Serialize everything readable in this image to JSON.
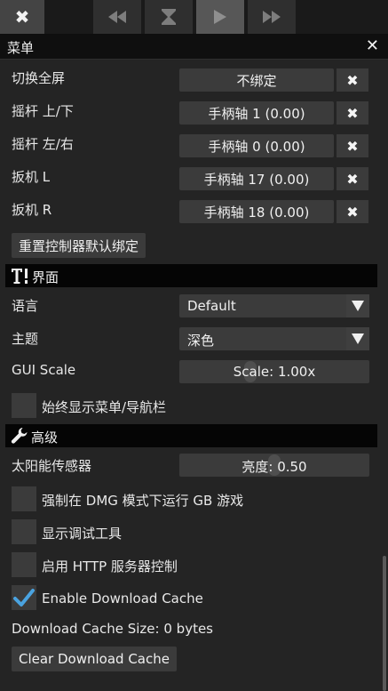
{
  "menu": {
    "title": "菜单"
  },
  "bindings": {
    "rows": [
      {
        "label": "切换全屏",
        "value": "不绑定"
      },
      {
        "label": "摇杆 上/下",
        "value": "手柄轴 1 (0.00)"
      },
      {
        "label": "摇杆 左/右",
        "value": "手柄轴 0 (0.00)"
      },
      {
        "label": "扳机 L",
        "value": "手柄轴 17 (0.00)"
      },
      {
        "label": "扳机 R",
        "value": "手柄轴 18 (0.00)"
      }
    ],
    "reset_label": "重置控制器默认绑定"
  },
  "interface": {
    "title": "界面",
    "language_label": "语言",
    "language_value": "Default",
    "theme_label": "主题",
    "theme_value": "深色",
    "gui_scale_label": "GUI Scale",
    "gui_scale_value": "Scale: 1.00x",
    "gui_scale_level": 0.25,
    "always_show_label": "始终显示菜单/导航栏",
    "always_show_checked": false
  },
  "advanced": {
    "title": "高级",
    "solar_label": "太阳能传感器",
    "solar_value": "亮度: 0.50",
    "solar_level": 0.5,
    "options": [
      {
        "label": "强制在 DMG 模式下运行 GB 游戏",
        "checked": false
      },
      {
        "label": "显示调试工具",
        "checked": false
      },
      {
        "label": "启用 HTTP 服务器控制",
        "checked": false
      },
      {
        "label": "Enable Download Cache",
        "checked": true
      }
    ],
    "cache_size": "Download Cache Size: 0 bytes",
    "clear_cache_label": "Clear Download Cache"
  },
  "colors": {
    "accent": "#4aa3e0",
    "panel": "#3b3b3b",
    "header": "#050505"
  }
}
